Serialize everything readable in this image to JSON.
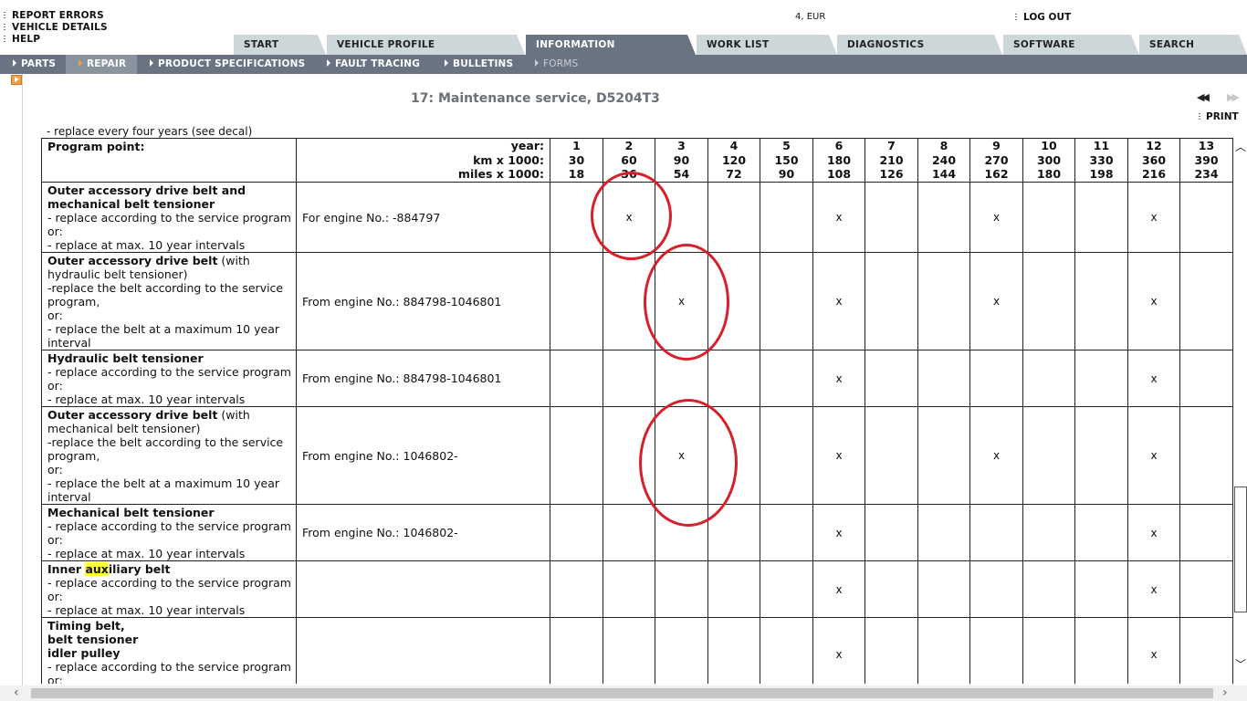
{
  "util_links": {
    "report_errors": "REPORT ERRORS",
    "vehicle_details": "VEHICLE DETAILS",
    "help": "HELP"
  },
  "market": "4, EUR",
  "logout": "LOG OUT",
  "main_tabs": [
    {
      "label": "START"
    },
    {
      "label": "VEHICLE PROFILE"
    },
    {
      "label": "INFORMATION",
      "active": true
    },
    {
      "label": "WORK LIST"
    },
    {
      "label": "DIAGNOSTICS"
    },
    {
      "label": "SOFTWARE"
    },
    {
      "label": "SEARCH"
    }
  ],
  "sub_nav": [
    {
      "label": "PARTS"
    },
    {
      "label": "REPAIR",
      "active": true
    },
    {
      "label": "PRODUCT SPECIFICATIONS"
    },
    {
      "label": "FAULT TRACING"
    },
    {
      "label": "BULLETINS"
    },
    {
      "label": "FORMS",
      "disabled": true
    }
  ],
  "doc": {
    "title": "17: Maintenance service, D5204T3",
    "print": "PRINT",
    "prev_icon": "double-left-arrow",
    "next_icon": "double-right-arrow"
  },
  "table": {
    "top_note": "- replace every four years (see decal)",
    "program_point_label": "Program point:",
    "year_label": "year:",
    "km_label": "km x 1000:",
    "miles_label": "miles x 1000:",
    "years": [
      "1",
      "2",
      "3",
      "4",
      "5",
      "6",
      "7",
      "8",
      "9",
      "10",
      "11",
      "12",
      "13"
    ],
    "km": [
      "30",
      "60",
      "90",
      "120",
      "150",
      "180",
      "210",
      "240",
      "270",
      "300",
      "330",
      "360",
      "390"
    ],
    "miles": [
      "18",
      "36",
      "54",
      "72",
      "90",
      "108",
      "126",
      "144",
      "162",
      "180",
      "198",
      "216",
      "234"
    ],
    "rows": [
      {
        "lines": [
          {
            "t": "Outer accessory drive belt and",
            "b": true
          },
          {
            "t": "mechanical belt tensioner",
            "b": true
          },
          {
            "t": "- replace according to the service program"
          },
          {
            "t": "or:"
          },
          {
            "t": "- replace at max. 10 year intervals"
          }
        ],
        "engine": "For engine No.: -884797",
        "marks": [
          "",
          "x",
          "",
          "",
          "",
          "x",
          "",
          "",
          "x",
          "",
          "",
          "x",
          ""
        ]
      },
      {
        "lines": [
          {
            "t": "Outer accessory drive belt",
            "b": true,
            "rest": " (with"
          },
          {
            "t": "hydraulic belt tensioner)"
          },
          {
            "t": "-replace the belt according to the service"
          },
          {
            "t": "program,"
          },
          {
            "t": "or:"
          },
          {
            "t": "- replace the belt at a maximum 10 year"
          },
          {
            "t": "interval"
          }
        ],
        "engine": "From engine No.: 884798-1046801",
        "marks": [
          "",
          "",
          "x",
          "",
          "",
          "x",
          "",
          "",
          "x",
          "",
          "",
          "x",
          ""
        ]
      },
      {
        "lines": [
          {
            "t": "Hydraulic belt tensioner",
            "b": true
          },
          {
            "t": "- replace according to the service program"
          },
          {
            "t": "or:"
          },
          {
            "t": "- replace at max. 10 year intervals"
          }
        ],
        "engine": "From engine No.: 884798-1046801",
        "marks": [
          "",
          "",
          "",
          "",
          "",
          "x",
          "",
          "",
          "",
          "",
          "",
          "x",
          ""
        ]
      },
      {
        "lines": [
          {
            "t": "Outer accessory drive belt",
            "b": true,
            "rest": " (with"
          },
          {
            "t": "mechanical belt tensioner)"
          },
          {
            "t": "-replace the belt according to the service"
          },
          {
            "t": "program,"
          },
          {
            "t": "or:"
          },
          {
            "t": "- replace the belt at a maximum 10 year"
          },
          {
            "t": "interval"
          }
        ],
        "engine": "From engine No.: 1046802-",
        "marks": [
          "",
          "",
          "x",
          "",
          "",
          "x",
          "",
          "",
          "x",
          "",
          "",
          "x",
          ""
        ]
      },
      {
        "lines": [
          {
            "t": "Mechanical belt tensioner",
            "b": true
          },
          {
            "t": "- replace according to the service program"
          },
          {
            "t": "or:"
          },
          {
            "t": "- replace at max. 10 year intervals"
          }
        ],
        "engine": "From engine No.: 1046802-",
        "marks": [
          "",
          "",
          "",
          "",
          "",
          "x",
          "",
          "",
          "",
          "",
          "",
          "x",
          ""
        ]
      },
      {
        "lines": [
          {
            "t": "Inner auxiliary belt",
            "b": true,
            "highlight": "aux"
          },
          {
            "t": "- replace according to the service program"
          },
          {
            "t": "or:"
          },
          {
            "t": "- replace at max. 10 year intervals"
          }
        ],
        "engine": "",
        "marks": [
          "",
          "",
          "",
          "",
          "",
          "x",
          "",
          "",
          "",
          "",
          "",
          "x",
          ""
        ]
      },
      {
        "lines": [
          {
            "t": "Timing belt,",
            "b": true
          },
          {
            "t": "belt tensioner",
            "b": true
          },
          {
            "t": "idler pulley",
            "b": true
          },
          {
            "t": "- replace according to the service program"
          },
          {
            "t": "or:"
          }
        ],
        "engine": "",
        "marks": [
          "",
          "",
          "",
          "",
          "",
          "x",
          "",
          "",
          "",
          "",
          "",
          "x",
          ""
        ]
      }
    ]
  },
  "colors": {
    "nav_bg": "#697381",
    "tab_bg": "#cdd6d9",
    "annotation": "#d7202a",
    "highlight": "#ffff33"
  }
}
